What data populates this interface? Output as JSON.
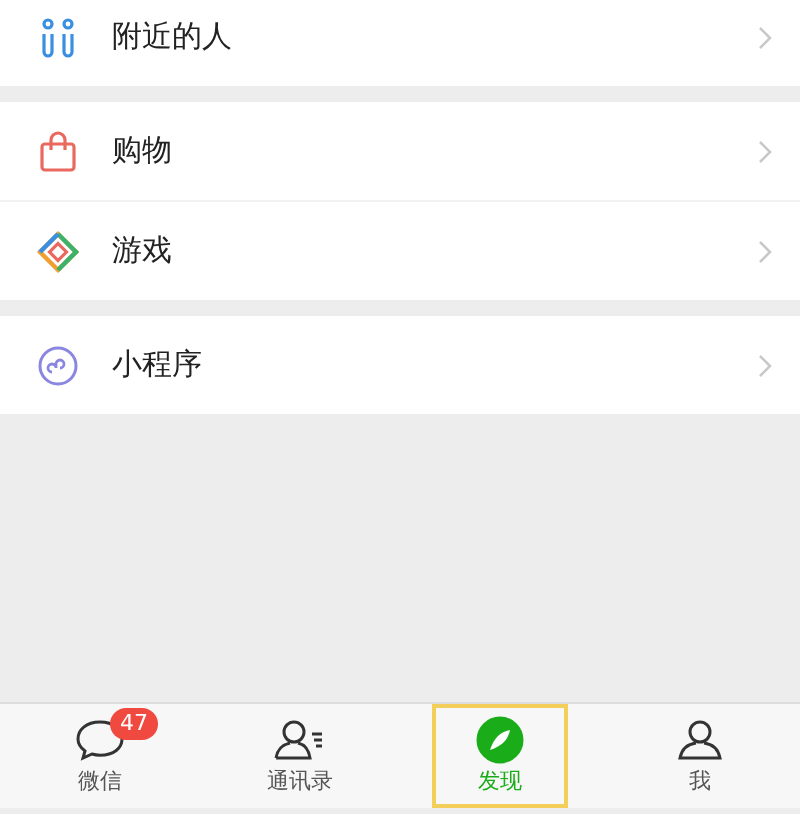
{
  "groups": [
    {
      "items": [
        {
          "kind": "people",
          "label": "附近的人"
        }
      ]
    },
    {
      "items": [
        {
          "kind": "bag",
          "label": "购物"
        },
        {
          "kind": "game",
          "label": "游戏"
        }
      ]
    },
    {
      "items": [
        {
          "kind": "miniprogram",
          "label": "小程序"
        }
      ]
    }
  ],
  "tabs": [
    {
      "kind": "chat",
      "label": "微信",
      "selected": false,
      "badge": "47",
      "highlighted": false
    },
    {
      "kind": "contacts",
      "label": "通讯录",
      "selected": false,
      "highlighted": false
    },
    {
      "kind": "discover",
      "label": "发现",
      "selected": true,
      "highlighted": true
    },
    {
      "kind": "me",
      "label": "我",
      "selected": false,
      "highlighted": false
    }
  ]
}
